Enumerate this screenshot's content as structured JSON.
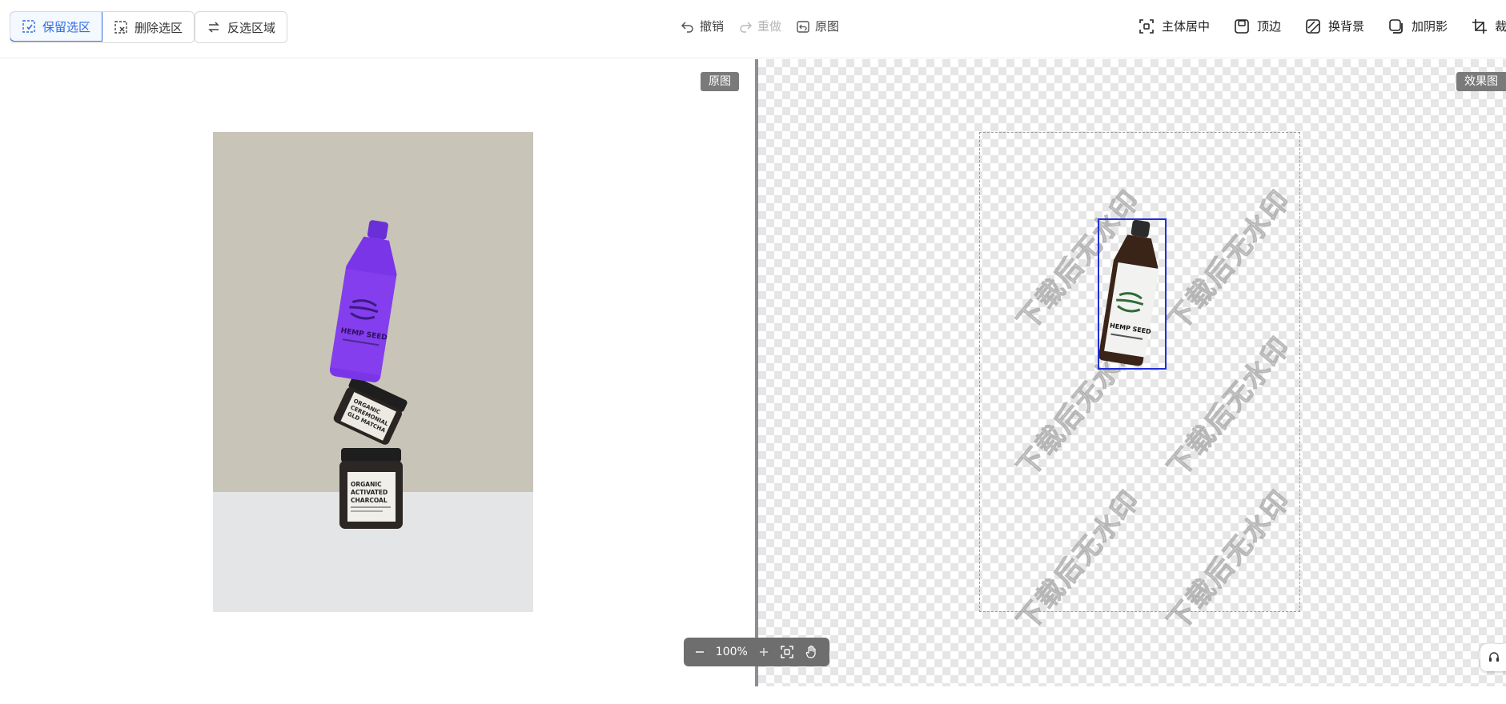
{
  "toolbar": {
    "keep_selection": "保留选区",
    "delete_selection": "删除选区",
    "invert_selection": "反选区域",
    "undo": "撤销",
    "redo": "重做",
    "original": "原图",
    "center_subject": "主体居中",
    "margin": "顶边",
    "change_background": "换背景",
    "add_shadow": "加阴影",
    "crop": "裁剪"
  },
  "left_pane": {
    "tag": "原图"
  },
  "right_pane": {
    "tag": "效果图",
    "watermark": "下载后无水印"
  },
  "photo_labels": {
    "bottle": "HEMP SEED",
    "jar_middle": [
      "ORGANIC",
      "CEREMONIAL",
      "GLD MATCHA"
    ],
    "jar_bottom": [
      "ORGANIC",
      "ACTIVATED",
      "CHARCOAL"
    ]
  },
  "zoom": {
    "level": "100%"
  },
  "icons": {
    "keep": "select-keep-icon",
    "delete": "select-delete-icon",
    "invert": "swap-icon",
    "undo": "undo-icon",
    "redo": "redo-icon",
    "original": "restore-icon",
    "center": "focus-center-icon",
    "margin": "margin-icon",
    "background": "background-icon",
    "shadow": "shadow-icon",
    "crop": "crop-icon",
    "support": "headset-icon"
  },
  "colors": {
    "accent": "#2d6cdf",
    "selection_box": "#1f2fd6",
    "tag_bg": "#7a7a7a"
  }
}
